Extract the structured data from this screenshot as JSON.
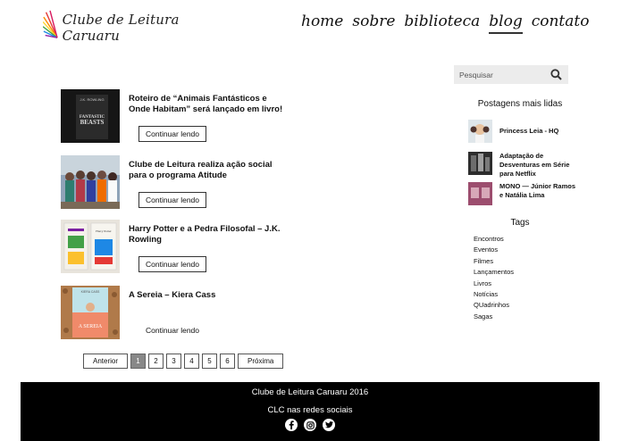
{
  "header": {
    "logo_text": "Clube de Leitura Caruaru",
    "nav": [
      "home",
      "sobre",
      "biblioteca",
      "blog",
      "contato"
    ],
    "active_nav": "blog"
  },
  "posts": [
    {
      "title": "Roteiro de “Animais Fantásticos e Onde Habitam” será lançado em livro!",
      "button": "Continuar lendo",
      "thumb_author": "J.K. ROWLING",
      "thumb_text": "FANTASTIC BEASTS"
    },
    {
      "title": "Clube de Leitura realiza ação social para o programa Atitude",
      "button": "Continuar lendo"
    },
    {
      "title": "Harry Potter e a Pedra Filosofal – J.K. Rowling",
      "button": "Continuar lendo",
      "thumb_text": "Harry Potter"
    },
    {
      "title": "A Sereia – Kiera Cass",
      "button": "Continuar lendo",
      "thumb_author": "KIERA CASS",
      "thumb_text": "A SEREIA"
    }
  ],
  "pagination": {
    "prev": "Anterior",
    "pages": [
      "1",
      "2",
      "3",
      "4",
      "5",
      "6"
    ],
    "current": "1",
    "next": "Próxima"
  },
  "sidebar": {
    "search_placeholder": "Pesquisar",
    "popular_heading": "Postagens mais lidas",
    "popular": [
      {
        "title": "Princess Leia - HQ"
      },
      {
        "title": "Adaptação de Desventuras em Série para Netflix"
      },
      {
        "title": "MONO — Júnior Ramos e Natália Lima"
      }
    ],
    "tags_heading": "Tags",
    "tags": [
      "Encontros",
      "Eventos",
      "Filmes",
      "Lançamentos",
      "Livros",
      "Notícias",
      "QUadrinhos",
      "Sagas"
    ]
  },
  "footer": {
    "copyright": "Clube de Leitura Caruaru 2016",
    "social_heading": "CLC nas redes sociais",
    "social": [
      "facebook-icon",
      "instagram-icon",
      "twitter-icon"
    ]
  },
  "colors": {
    "footer_bg": "#000000",
    "search_bg": "#ececec",
    "active_page": "#888888"
  }
}
